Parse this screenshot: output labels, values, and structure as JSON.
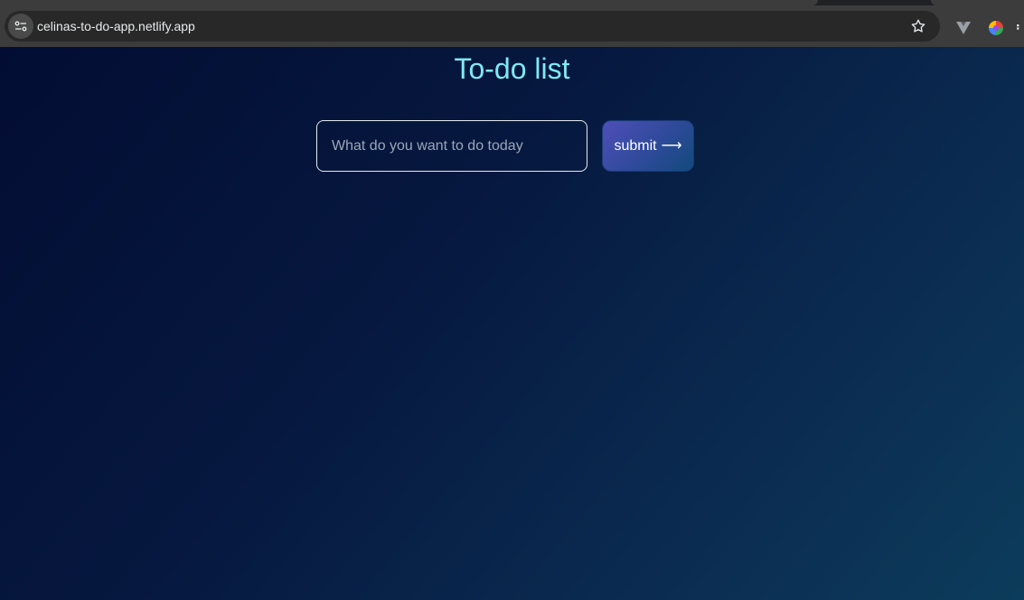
{
  "browser": {
    "url": "celinas-to-do-app.netlify.app",
    "icons": [
      "site-info-icon",
      "bookmark-star-icon",
      "vue-devtools-icon",
      "color-wheel-extension-icon",
      "extensions-icon"
    ]
  },
  "app": {
    "title": "To-do list",
    "input": {
      "placeholder": "What do you want to do today",
      "value": ""
    },
    "submit_label": "submit",
    "submit_arrow": "⟶"
  },
  "colors": {
    "title": "#7ee9f4",
    "background_start": "#030d33",
    "background_end": "#0c3c5b",
    "button_start": "#4f4fb8",
    "button_end": "#134a7c"
  }
}
